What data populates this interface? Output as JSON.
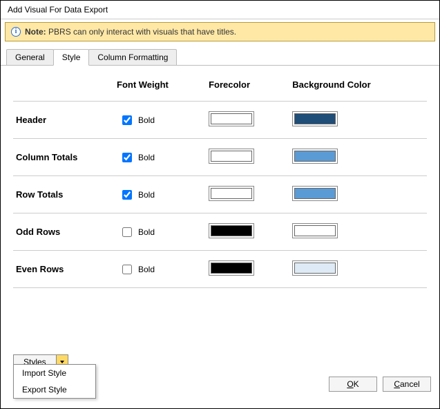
{
  "title": "Add Visual For Data Export",
  "note": {
    "label": "Note:",
    "text": "PBRS can only interact with visuals that have titles."
  },
  "tabs": {
    "general": "General",
    "style": "Style",
    "column_formatting": "Column Formatting",
    "active": "style"
  },
  "headers": {
    "font_weight": "Font Weight",
    "forecolor": "Forecolor",
    "background": "Background Color"
  },
  "rows": [
    {
      "label": "Header",
      "bold_label": "Bold",
      "bold": true,
      "forecolor": "#ffffff",
      "background": "#1f4e79"
    },
    {
      "label": "Column Totals",
      "bold_label": "Bold",
      "bold": true,
      "forecolor": "#ffffff",
      "background": "#5b9bd5"
    },
    {
      "label": "Row Totals",
      "bold_label": "Bold",
      "bold": true,
      "forecolor": "#ffffff",
      "background": "#5b9bd5"
    },
    {
      "label": "Odd Rows",
      "bold_label": "Bold",
      "bold": false,
      "forecolor": "#000000",
      "background": "#ffffff"
    },
    {
      "label": "Even Rows",
      "bold_label": "Bold",
      "bold": false,
      "forecolor": "#000000",
      "background": "#deebf7"
    }
  ],
  "styles_button": "Styles",
  "styles_menu": {
    "import": "Import Style",
    "export": "Export Style"
  },
  "buttons": {
    "ok": "OK",
    "cancel": "Cancel"
  }
}
